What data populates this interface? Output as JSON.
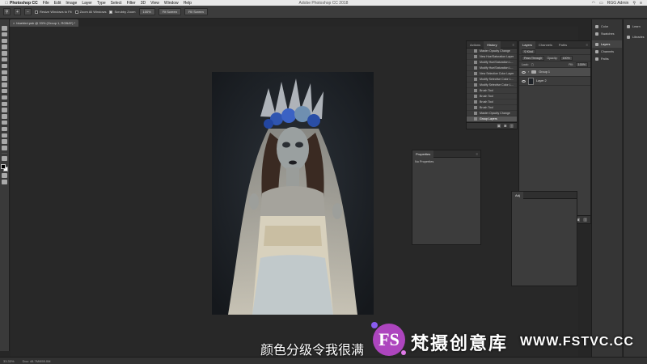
{
  "menubar": {
    "app_name": "Photoshop CC",
    "items": [
      "File",
      "Edit",
      "Image",
      "Layer",
      "Type",
      "Select",
      "Filter",
      "3D",
      "View",
      "Window",
      "Help"
    ],
    "window_title": "Adobe Photoshop CC 2018",
    "user": "RGG Admin"
  },
  "options": {
    "resize_windows": "Resize Windows to Fit",
    "zoom_all": "Zoom All Windows",
    "scrubby_zoom": "Scrubby Zoom",
    "btn_100": "100%",
    "btn_fit": "Fit Screen",
    "btn_fill": "Fill Screen"
  },
  "document": {
    "tab_label": "bluebird.psb @ 33% (Group 1, RGB/8*) *"
  },
  "history": {
    "tabs": [
      "Actions",
      "History"
    ],
    "rows": [
      "Master Opacity Change",
      "New Hue/Saturation Layer",
      "Modify Hue/Saturation L...",
      "Modify Hue/Saturation L...",
      "New Selective Color Layer",
      "Modify Selective Color L...",
      "Modify Selective Color L...",
      "Brush Tool",
      "Brush Tool",
      "Brush Tool",
      "Brush Tool",
      "Master Opacity Change",
      "Group Layers"
    ]
  },
  "layers": {
    "tabs": [
      "Layers",
      "Channels",
      "Paths"
    ],
    "kind": "Kind",
    "blend_mode": "Pass Through",
    "opacity_label": "Opacity:",
    "opacity": "100%",
    "lock_label": "Lock:",
    "fill_label": "Fill:",
    "fill": "100%",
    "rows": [
      "Group 1",
      "Layer 2"
    ]
  },
  "properties": {
    "title": "Properties",
    "body": "No Properties"
  },
  "adjustments": {
    "title": "Adj"
  },
  "dock1": [
    "Color",
    "Swatches",
    "Layers",
    "Channels",
    "Paths"
  ],
  "dock2": [
    "Learn",
    "Libraries"
  ],
  "status": {
    "zoom": "33.33%",
    "doc": "Doc: 48.7M/655.0M"
  },
  "overlay": {
    "subtitle": "颜色分级令我很满",
    "brand_zh": "梵摄创意库",
    "brand_url": "WWW.FSTVC.CC"
  }
}
